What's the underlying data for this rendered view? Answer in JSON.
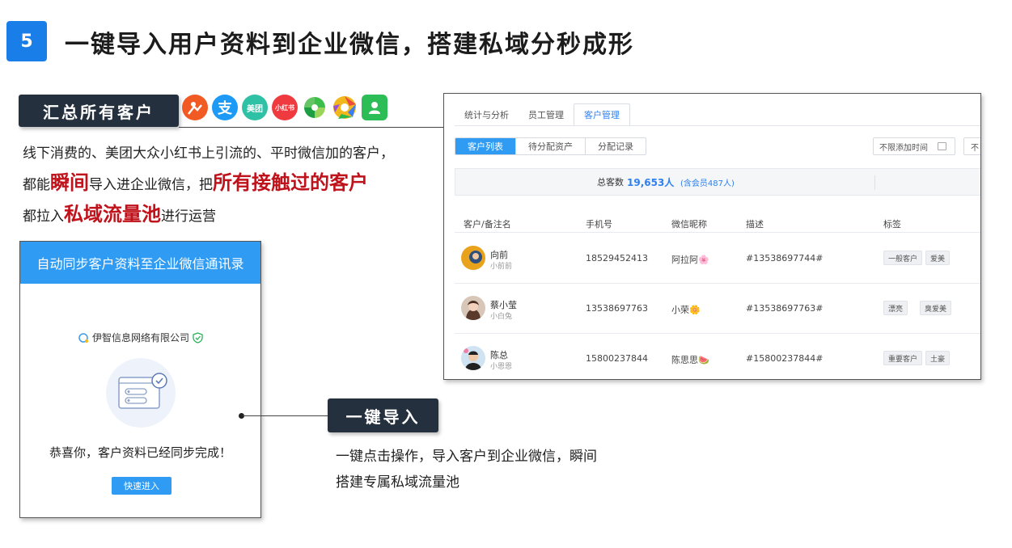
{
  "header": {
    "step": "5",
    "title": "一键导入用户资料到企业微信，搭建私域分秒成形"
  },
  "summary_label": "汇总所有客户",
  "app_icons": [
    {
      "name": "dianping-icon",
      "text": "",
      "color": "#f25a23"
    },
    {
      "name": "alipay-icon",
      "text": "支",
      "color": "#1c9af5"
    },
    {
      "name": "meituan-icon",
      "text": "美团",
      "color": "#2fc1a5"
    },
    {
      "name": "xiaohongshu-icon",
      "text": "小红书",
      "color": "#ef3b3f"
    },
    {
      "name": "wechat-moments-icon",
      "text": "",
      "color": "#3cbf4a"
    },
    {
      "name": "camera-aperture-icon",
      "text": "",
      "color": "#f2b71a"
    },
    {
      "name": "contacts-icon",
      "text": "",
      "color": "#2dbd57"
    }
  ],
  "description": {
    "line1": "线下消费的、美团大众小红书上引流的、平时微信加的客户，",
    "line2_a": "都能",
    "line2_hl1": "瞬间",
    "line2_b": "导入进企业微信，把",
    "line2_hl2": "所有接触过的客户",
    "line3_a": "都拉入",
    "line3_hl": "私域流量池",
    "line3_b": "进行运营"
  },
  "sync_card": {
    "header": "自动同步客户资料至企业微信通讯录",
    "company": "伊智信息网络有限公司",
    "success": "恭喜你，客户资料已经同步完成！",
    "enter_button": "快速进入"
  },
  "import_label": "一键导入",
  "import_desc": {
    "line1": "一键点击操作，导入客户到企业微信，瞬间",
    "line2": "搭建专属私域流量池"
  },
  "crm": {
    "tabs": [
      "统计与分析",
      "员工管理",
      "客户管理"
    ],
    "active_tab": "客户管理",
    "segments": [
      "客户列表",
      "待分配资产",
      "分配记录"
    ],
    "date_filter": "不限添加时间",
    "date_filter_2": "不",
    "stats": {
      "label": "总客数",
      "value": "19,653人",
      "sub": "(含会员487人)"
    },
    "columns": [
      "客户/备注名",
      "手机号",
      "微信昵称",
      "描述",
      "标签"
    ],
    "rows": [
      {
        "name": "向前",
        "remark": "小前前",
        "phone": "18529452413",
        "nickname": "阿拉阿🌸",
        "desc": "#13538697744#",
        "tags": [
          "一般客户",
          "爱美"
        ]
      },
      {
        "name": "蔡小莹",
        "remark": "小白兔",
        "phone": "13538697763",
        "nickname": "小荣🌼",
        "desc": "#13538697763#",
        "tags": [
          "漂亮",
          "臭爱美"
        ]
      },
      {
        "name": "陈总",
        "remark": "小恩恩",
        "phone": "15800237844",
        "nickname": "陈思思🍉",
        "desc": "#15800237844#",
        "tags": [
          "重要客户",
          "土豪"
        ]
      }
    ]
  }
}
